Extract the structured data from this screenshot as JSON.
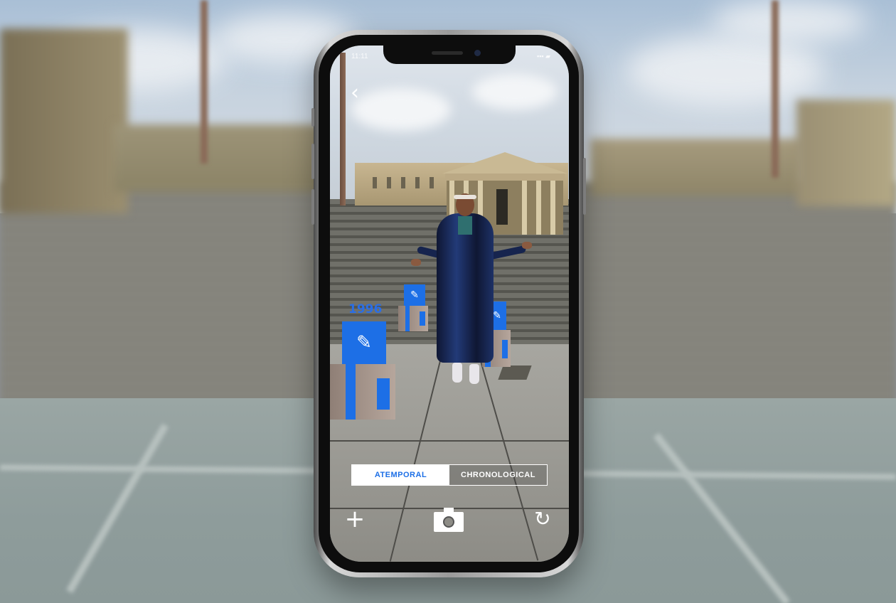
{
  "status_bar": {
    "time": "11:11",
    "right": "▪▪▪ ▰"
  },
  "navigation": {
    "back_icon": "chevron-left-icon",
    "back_glyph": "‹"
  },
  "ar_markers": [
    {
      "year": "1996",
      "icon": "document-icon"
    },
    {
      "year": "",
      "icon": "document-icon"
    },
    {
      "year": "",
      "icon": "document-icon"
    }
  ],
  "mode_toggle": {
    "options": [
      "ATEMPORAL",
      "CHRONOLOGICAL"
    ],
    "selected": "ATEMPORAL"
  },
  "bottom_bar": {
    "add_icon": "plus-icon",
    "add_glyph": "+",
    "capture_icon": "camera-icon",
    "reset_icon": "refresh-icon",
    "reset_glyph": "↻"
  },
  "colors": {
    "accent": "#1d6fe6",
    "toggle_active_bg": "#ffffff",
    "toggle_text_inactive": "#ffffff"
  }
}
